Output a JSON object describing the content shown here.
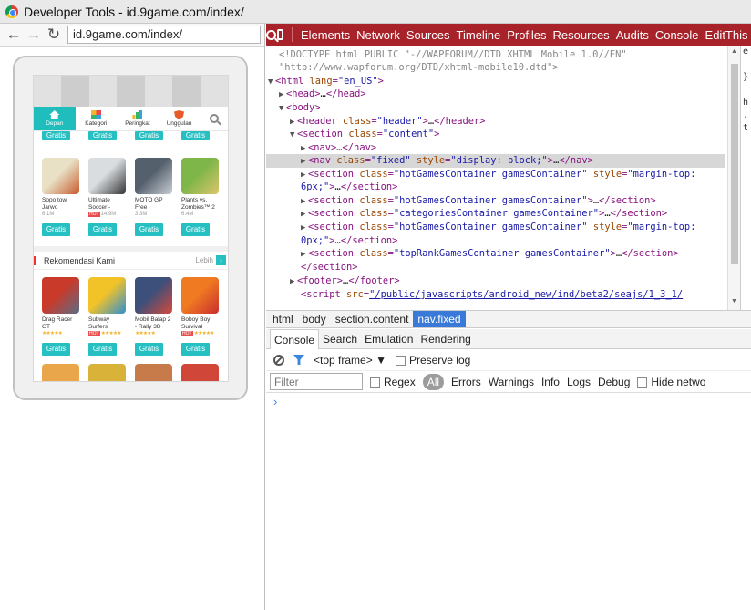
{
  "window": {
    "title": "Developer Tools - id.9game.com/index/"
  },
  "browser": {
    "url": "id.9game.com/index/",
    "back_icon": "back-arrow-icon",
    "forward_icon": "forward-arrow-icon",
    "reload_icon": "reload-icon"
  },
  "site": {
    "tabs": [
      {
        "label": "Depan",
        "icon": "home-icon"
      },
      {
        "label": "Kategori",
        "icon": "category-icon"
      },
      {
        "label": "Peringkat",
        "icon": "ranking-icon"
      },
      {
        "label": "Unggulan",
        "icon": "featured-icon"
      }
    ],
    "gratis_label": "Gratis",
    "apps_row1": [
      {
        "name": "Sopo tow Jarwo",
        "meta": "6.1M",
        "hot": "",
        "colors": [
          "#e8e1c5",
          "#c85a2e"
        ]
      },
      {
        "name": "Ultimate Soccer -",
        "meta": "14.9M",
        "hot": "HOT",
        "colors": [
          "#d9dde0",
          "#333333"
        ]
      },
      {
        "name": "MOTO GP Free",
        "meta": "3.3M",
        "hot": "",
        "colors": [
          "#55606d",
          "#c9ced4"
        ]
      },
      {
        "name": "Plants vs. Zombies™ 2",
        "meta": "6.4M",
        "hot": "",
        "colors": [
          "#7fb64a",
          "#dcc56a"
        ]
      }
    ],
    "section_title": "Rekomendasi Kami",
    "section_more": "Lebih",
    "apps_row2": [
      {
        "name": "Drag Racer GT",
        "hot": "",
        "stars": "★★★★★",
        "colors": [
          "#c93a2a",
          "#5b6d85"
        ]
      },
      {
        "name": "Subway Surfers",
        "hot": "HOT",
        "stars": "★★★★★",
        "colors": [
          "#f2c229",
          "#2f8fd1"
        ]
      },
      {
        "name": "Mobil Balap 2 - Rally 3D",
        "hot": "",
        "stars": "★★★★★",
        "colors": [
          "#3d4f7b",
          "#d54a3b"
        ]
      },
      {
        "name": "Boboy Boy Survival",
        "hot": "HOT",
        "stars": "★★★★★",
        "colors": [
          "#f07a22",
          "#c92e2e"
        ]
      }
    ]
  },
  "devtools": {
    "panels": [
      "Elements",
      "Network",
      "Sources",
      "Timeline",
      "Profiles",
      "Resources",
      "Audits",
      "Console",
      "EditThis"
    ],
    "doctype_1": "<!DOCTYPE html PUBLIC \"-//WAPFORUM//DTD XHTML Mobile 1.0//EN\"",
    "doctype_2": "\"http://www.wapforum.org/DTD/xhtml-mobile10.dtd\">",
    "html_lang": "\"en_US\"",
    "section_content": "\"content\"",
    "nav_fixed_class": "\"fixed\"",
    "nav_fixed_style": "\"display: block;\"",
    "hot_games_class": "\"hotGamesContainer gamesContainer\"",
    "margin_top_6a": "\"margin-top:",
    "margin_top_6b": "6px;\"",
    "categories_class": "\"categoriesContainer gamesContainer\"",
    "margin_top_0a": "\"margin-top:",
    "margin_top_0b": "0px;\"",
    "toprank_class": "\"topRankGamesContainer gamesContainer\"",
    "header_class": "\"header\"",
    "script_src": "\"/public/javascripts/android_new/ind/beta2/seajs/1_3_1/",
    "breadcrumbs": [
      "html",
      "body",
      "section.content",
      "nav.fixed"
    ],
    "drawer_tabs": [
      "Console",
      "Search",
      "Emulation",
      "Rendering"
    ],
    "frame_select": "<top frame>",
    "preserve_log": "Preserve log",
    "filter_placeholder": "Filter",
    "regex": "Regex",
    "levels": [
      "All",
      "Errors",
      "Warnings",
      "Info",
      "Logs",
      "Debug"
    ],
    "hide_network": "Hide netwo",
    "prompt": "›",
    "side_pane_chars": "e\n \n}\n \nh\n.\nt"
  }
}
